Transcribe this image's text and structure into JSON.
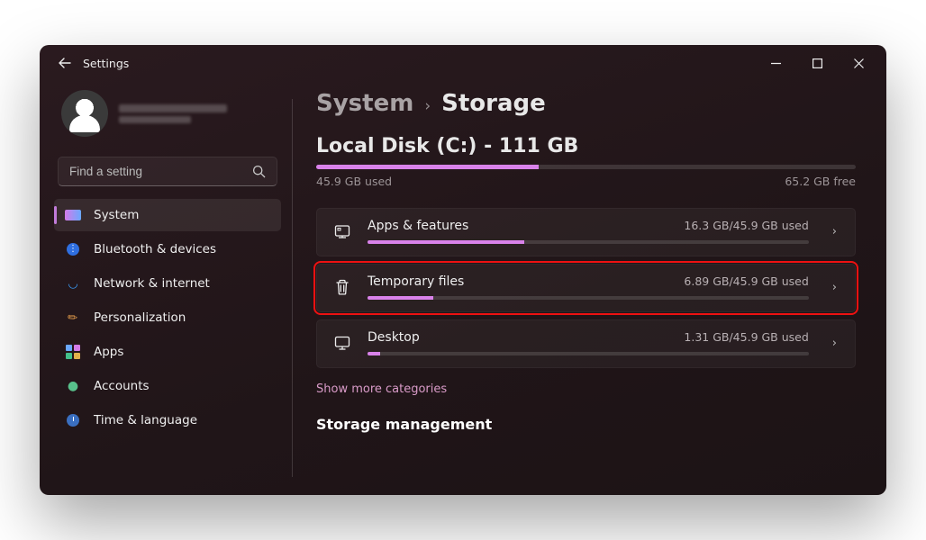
{
  "titlebar": {
    "title": "Settings"
  },
  "search": {
    "placeholder": "Find a setting"
  },
  "nav": {
    "items": [
      {
        "label": "System"
      },
      {
        "label": "Bluetooth & devices"
      },
      {
        "label": "Network & internet"
      },
      {
        "label": "Personalization"
      },
      {
        "label": "Apps"
      },
      {
        "label": "Accounts"
      },
      {
        "label": "Time & language"
      }
    ]
  },
  "breadcrumb": {
    "parent": "System",
    "current": "Storage"
  },
  "disk": {
    "title": "Local Disk (C:) - 111 GB",
    "used_label": "45.9 GB used",
    "free_label": "65.2 GB free",
    "used_pct": 41.3
  },
  "categories": [
    {
      "title": "Apps & features",
      "usage": "16.3 GB/45.9 GB used",
      "pct": 35.5,
      "icon": "apps"
    },
    {
      "title": "Temporary files",
      "usage": "6.89 GB/45.9 GB used",
      "pct": 15.0,
      "icon": "trash",
      "highlight": true
    },
    {
      "title": "Desktop",
      "usage": "1.31 GB/45.9 GB used",
      "pct": 2.9,
      "icon": "monitor"
    }
  ],
  "show_more": "Show more categories",
  "storage_mgmt_title": "Storage management"
}
